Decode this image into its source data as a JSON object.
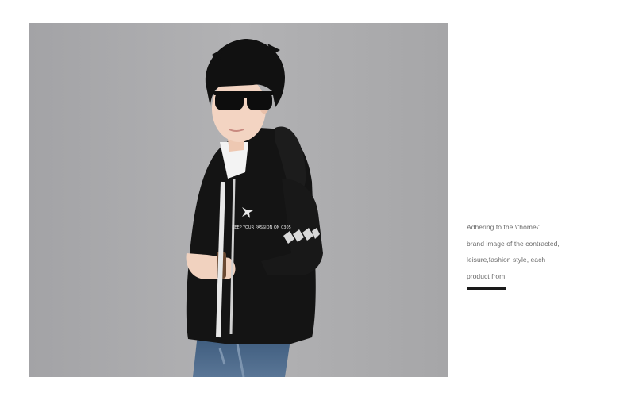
{
  "product_image": {
    "alt": "Boy wearing sunglasses and a black hooded jacket",
    "jacket_print": "KEEP YOUR PASSION ON 0305"
  },
  "description": {
    "lines": [
      "Adhering to the \\\"home\\\"",
      "brand image of the contracted,",
      "leisure,fashion style, each",
      "product from"
    ]
  },
  "colors": {
    "background": "#ffffff",
    "photo_backdrop": "#a9a9ab",
    "jacket": "#141414",
    "text": "#6a6a6a",
    "accent_rule": "#1a1a1a"
  }
}
